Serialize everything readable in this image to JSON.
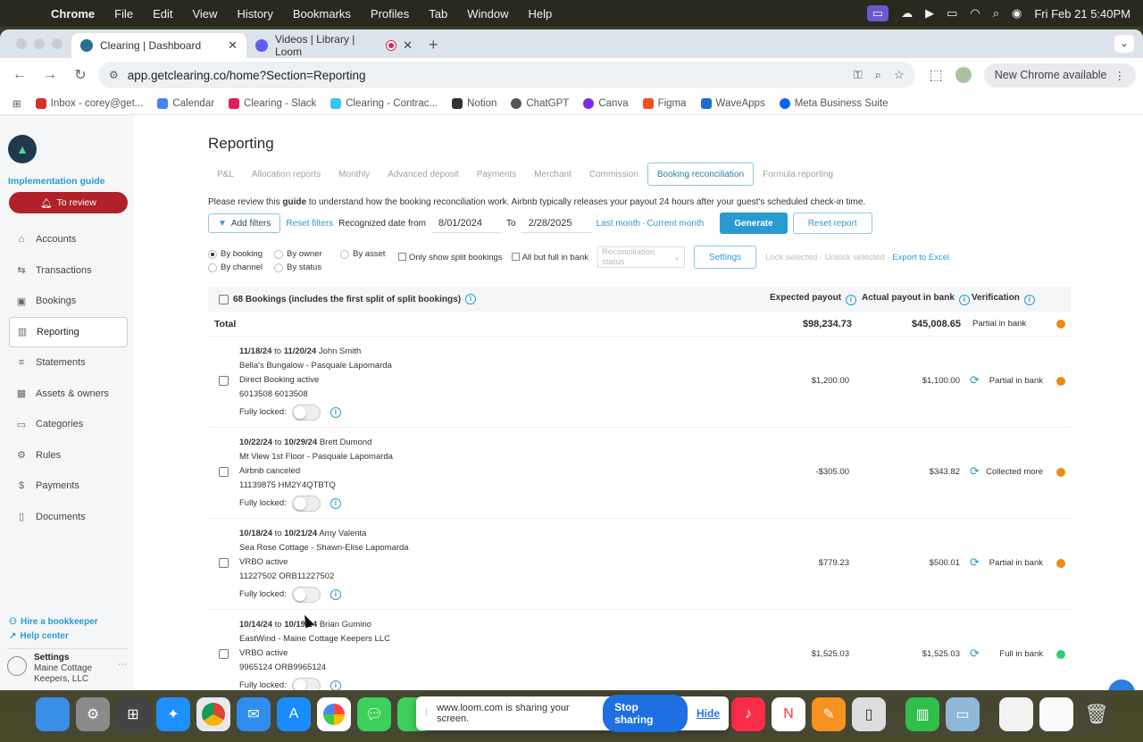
{
  "menubar": {
    "app": "Chrome",
    "items": [
      "File",
      "Edit",
      "View",
      "History",
      "Bookmarks",
      "Profiles",
      "Tab",
      "Window",
      "Help"
    ],
    "datetime": "Fri Feb 21  5:40PM"
  },
  "browser": {
    "tabs": [
      {
        "title": "Clearing | Dashboard"
      },
      {
        "title": "Videos | Library | Loom"
      }
    ],
    "url": "app.getclearing.co/home?Section=Reporting",
    "new_chrome": "New Chrome available",
    "bookmarks": [
      {
        "label": "Inbox - corey@get...",
        "color": "#d93025"
      },
      {
        "label": "Calendar",
        "color": "#4285f4"
      },
      {
        "label": "Clearing - Slack",
        "color": "#e01e5a"
      },
      {
        "label": "Clearing - Contrac...",
        "color": "#36c5f0"
      },
      {
        "label": "Notion",
        "color": "#333333"
      },
      {
        "label": "ChatGPT",
        "color": "#555555"
      },
      {
        "label": "Canva",
        "color": "#7d2ae8"
      },
      {
        "label": "Figma",
        "color": "#f24e1e"
      },
      {
        "label": "WaveApps",
        "color": "#1c6dd0"
      },
      {
        "label": "Meta Business Suite",
        "color": "#0866ff"
      }
    ]
  },
  "sidebar": {
    "implementation_guide": "Implementation guide",
    "to_review": "To review",
    "items": [
      {
        "label": "Accounts",
        "icon": "bank-icon"
      },
      {
        "label": "Transactions",
        "icon": "arrows-icon"
      },
      {
        "label": "Bookings",
        "icon": "calendar-icon"
      },
      {
        "label": "Reporting",
        "icon": "bar-chart-icon"
      },
      {
        "label": "Statements",
        "icon": "stack-icon"
      },
      {
        "label": "Assets & owners",
        "icon": "building-icon"
      },
      {
        "label": "Categories",
        "icon": "folder-icon"
      },
      {
        "label": "Rules",
        "icon": "gear-icon"
      },
      {
        "label": "Payments",
        "icon": "dollar-icon"
      },
      {
        "label": "Documents",
        "icon": "document-icon"
      }
    ],
    "hire": "Hire a bookkeeper",
    "help": "Help center",
    "settings_label": "Settings",
    "org_line1": "Maine Cottage",
    "org_line2": "Keepers, LLC"
  },
  "main": {
    "title": "Reporting",
    "tabs": [
      "P&L",
      "Allocation reports",
      "Monthly",
      "Advanced deposit",
      "Payments",
      "Merchant",
      "Commission",
      "Booking reconciliation",
      "Formula reporting"
    ],
    "notice_pre": "Please review this ",
    "notice_guide": "guide",
    "notice_post": " to understand how the booking reconciliation work. Airbnb typically releases your payout 24 hours after your guest's scheduled check-in time.",
    "add_filters": "Add filters",
    "reset_filters": "Reset filters",
    "recognized_date_from": "Recognized date from",
    "date_from": "8/01/2024",
    "to": "To",
    "date_to": "2/28/2025",
    "last_month": "Last month",
    "current_month": "Current month",
    "generate": "Generate",
    "reset_report": "Reset report",
    "radios": [
      "By booking",
      "By owner",
      "By asset",
      "By channel",
      "By status"
    ],
    "only_split": "Only show split bookings",
    "all_but_full": "All but full in bank",
    "recon_status_placeholder": "Reconciliation status",
    "settings": "Settings",
    "lock_selected": "Lock selected",
    "unlock_selected": "Unlock selected",
    "export": "Export to Excel"
  },
  "table": {
    "header_count": "68 Bookings (includes the first split of split bookings)",
    "col_expected": "Expected payout",
    "col_actual": "Actual payout in bank",
    "col_verification": "Verification",
    "total_label": "Total",
    "total_expected": "$98,234.73",
    "total_actual": "$45,008.65",
    "total_verification": "Partial in bank",
    "total_status_color": "#ee8a12",
    "fully_locked_label": "Fully locked:",
    "rows": [
      {
        "from": "11/18/24",
        "to": "11/20/24",
        "guest": "John Smith",
        "property": "Bella's Bungalow - Pasquale Lapomarda",
        "channel": "Direct Booking active",
        "ids": "6013508  6013508",
        "expected": "$1,200.00",
        "actual": "$1,100.00",
        "verification": "Partial in bank",
        "status": "orange"
      },
      {
        "from": "10/22/24",
        "to": "10/29/24",
        "guest": "Brett Dumond",
        "property": "Mt View 1st Floor - Pasquale Lapomarda",
        "channel": "Airbnb canceled",
        "ids": "11139875  HM2Y4QTBTQ",
        "expected": "-$305.00",
        "actual": "$343.82",
        "verification": "Collected more",
        "status": "orange"
      },
      {
        "from": "10/18/24",
        "to": "10/21/24",
        "guest": "Amy Valenta",
        "property": "Sea Rose Cottage - Shawn-Elise Lapomarda",
        "channel": "VRBO active",
        "ids": "11227502  ORB11227502",
        "expected": "$779.23",
        "actual": "$500.01",
        "verification": "Partial in bank",
        "status": "orange"
      },
      {
        "from": "10/14/24",
        "to": "10/19/24",
        "guest": "Brian Gumino",
        "property": "EastWind - Maine Cottage Keepers LLC",
        "channel": "VRBO active",
        "ids": "9965124  ORB9965124",
        "expected": "$1,525.03",
        "actual": "$1,525.03",
        "verification": "Full in bank",
        "status": "green"
      }
    ],
    "to_sep": "to"
  },
  "loom": {
    "message": "www.loom.com is sharing your screen.",
    "stop": "Stop sharing",
    "hide": "Hide"
  }
}
